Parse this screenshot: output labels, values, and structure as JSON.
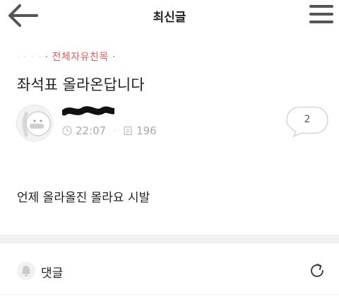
{
  "header": {
    "title": "최신글"
  },
  "post": {
    "category": "· 전체자유친목 ·",
    "title": "좌석표 올라온답니다",
    "time": "22:07",
    "views": "196",
    "comment_count": "2",
    "body": "언제 올라올진 몰라요 시발"
  },
  "comments": {
    "label": "댓글"
  },
  "colors": {
    "category": "#e05a5a",
    "meta": "#aaaaaa",
    "divider": "#f2f2f2"
  },
  "icons": [
    "back-arrow-icon",
    "hamburger-menu-icon",
    "clock-icon",
    "document-icon",
    "comment-bubble-icon",
    "bell-icon",
    "refresh-icon"
  ]
}
